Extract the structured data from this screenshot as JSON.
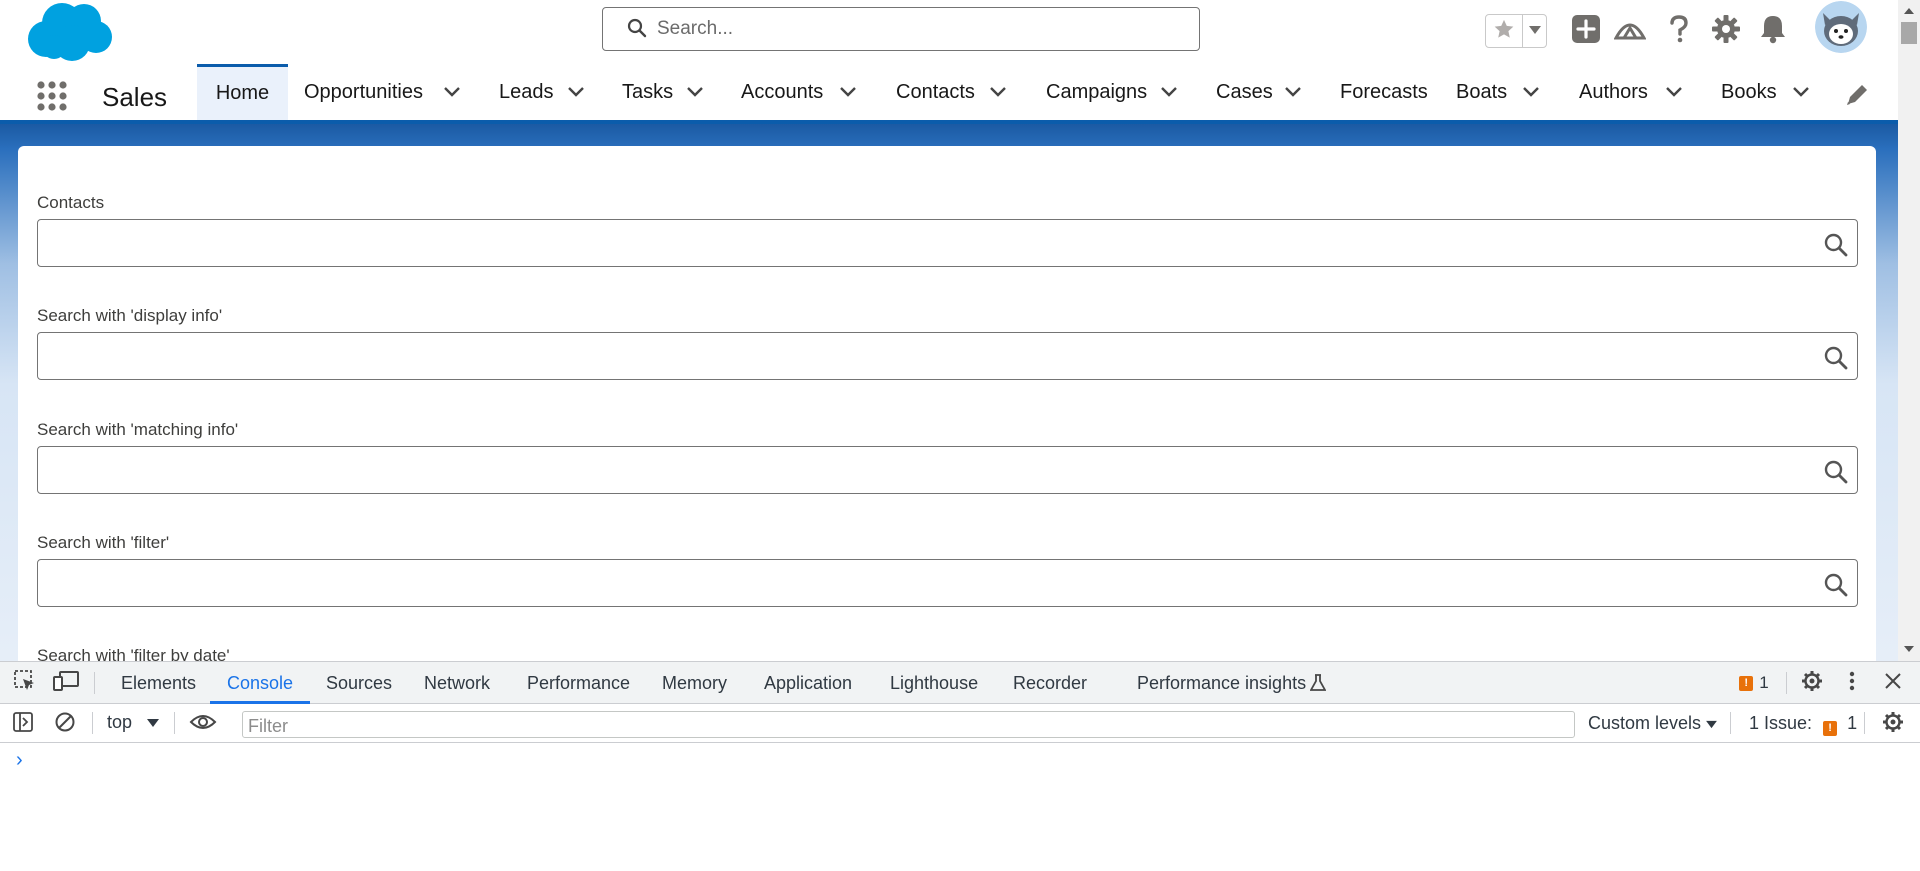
{
  "header": {
    "search_placeholder": "Search...",
    "icons": [
      "salesforce-cloud-logo",
      "search-icon",
      "star-icon",
      "chevron-down-icon",
      "add-icon",
      "trailhead-icon",
      "help-icon",
      "gear-icon",
      "bell-icon",
      "avatar"
    ]
  },
  "nav": {
    "app_name": "Sales",
    "items": [
      {
        "label": "Home",
        "active": true
      },
      {
        "label": "Opportunities"
      },
      {
        "label": "Leads"
      },
      {
        "label": "Tasks"
      },
      {
        "label": "Accounts"
      },
      {
        "label": "Contacts"
      },
      {
        "label": "Campaigns"
      },
      {
        "label": "Cases"
      },
      {
        "label": "Forecasts"
      },
      {
        "label": "Boats"
      },
      {
        "label": "Authors"
      },
      {
        "label": "Books"
      }
    ]
  },
  "form": {
    "fields": [
      {
        "label": "Contacts",
        "value": ""
      },
      {
        "label": "Search with 'display info'",
        "value": ""
      },
      {
        "label": "Search with 'matching info'",
        "value": ""
      },
      {
        "label": "Search with 'filter'",
        "value": ""
      },
      {
        "label": "Search with 'filter by date'",
        "value": ""
      }
    ]
  },
  "devtools": {
    "tabs": [
      "Elements",
      "Console",
      "Sources",
      "Network",
      "Performance",
      "Memory",
      "Application",
      "Lighthouse",
      "Recorder",
      "Performance insights"
    ],
    "active_tab": "Console",
    "issues_badge_count": "1",
    "context": "top",
    "filter_placeholder": "Filter",
    "levels": "Custom levels",
    "issues_label": "1 Issue:",
    "issues_count": "1",
    "prompt": "›"
  },
  "colors": {
    "brand_blue": "#0b5cab",
    "salesforce_cloud": "#00a1e0",
    "devtools_accent": "#1a73e8",
    "issue_orange": "#e8710a"
  }
}
